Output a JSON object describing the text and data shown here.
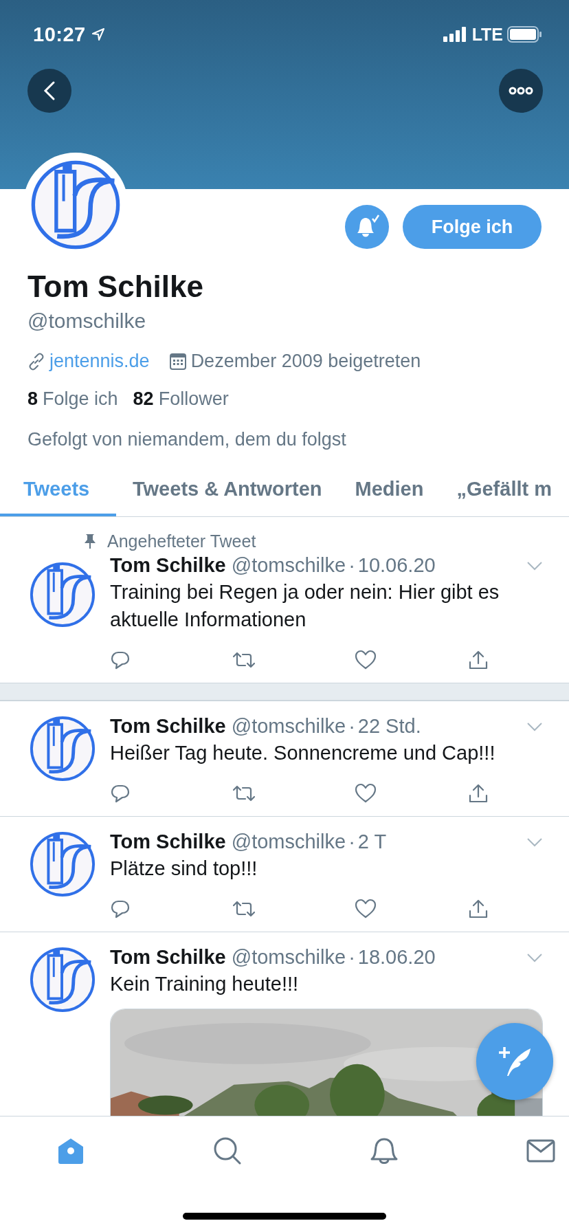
{
  "status_bar": {
    "time": "10:27",
    "network": "LTE"
  },
  "profile": {
    "name": "Tom Schilke",
    "handle": "@tomschilke",
    "website": "jentennis.de",
    "joined": "Dezember 2009 beigetreten",
    "notifications_on": true,
    "follow_button": "Folge ich",
    "stats": [
      {
        "count": "8",
        "label": "Folge ich"
      },
      {
        "count": "82",
        "label": "Follower"
      }
    ],
    "followed_by": "Gefolgt von niemandem, dem du folgst"
  },
  "tabs": [
    {
      "label": "Tweets",
      "selected": true
    },
    {
      "label": "Tweets & Antworten",
      "selected": false
    },
    {
      "label": "Medien",
      "selected": false
    },
    {
      "label": "„Gefällt m",
      "selected": false
    }
  ],
  "tweets": [
    {
      "pinned_label": "Angehefteter Tweet",
      "name": "Tom Schilke",
      "handle": "@tomschilke",
      "dot": "·",
      "time": "10.06.20",
      "text": "Training bei Regen ja oder nein: Hier gibt es aktuelle Informationen"
    },
    {
      "name": "Tom Schilke",
      "handle": "@tomschilke",
      "dot": "·",
      "time": "22 Std.",
      "text": "Heißer Tag heute. Sonnencreme und Cap!!!"
    },
    {
      "name": "Tom Schilke",
      "handle": "@tomschilke",
      "dot": "·",
      "time": "2 T",
      "text": "Plätze sind top!!!"
    },
    {
      "name": "Tom Schilke",
      "handle": "@tomschilke",
      "dot": "·",
      "time": "18.06.20",
      "text": "Kein Training heute!!!"
    }
  ],
  "bottom_nav": [
    {
      "kind": "home",
      "selected": true
    },
    {
      "kind": "search",
      "selected": false
    },
    {
      "kind": "notifications",
      "selected": false
    },
    {
      "kind": "messages",
      "selected": false
    }
  ]
}
